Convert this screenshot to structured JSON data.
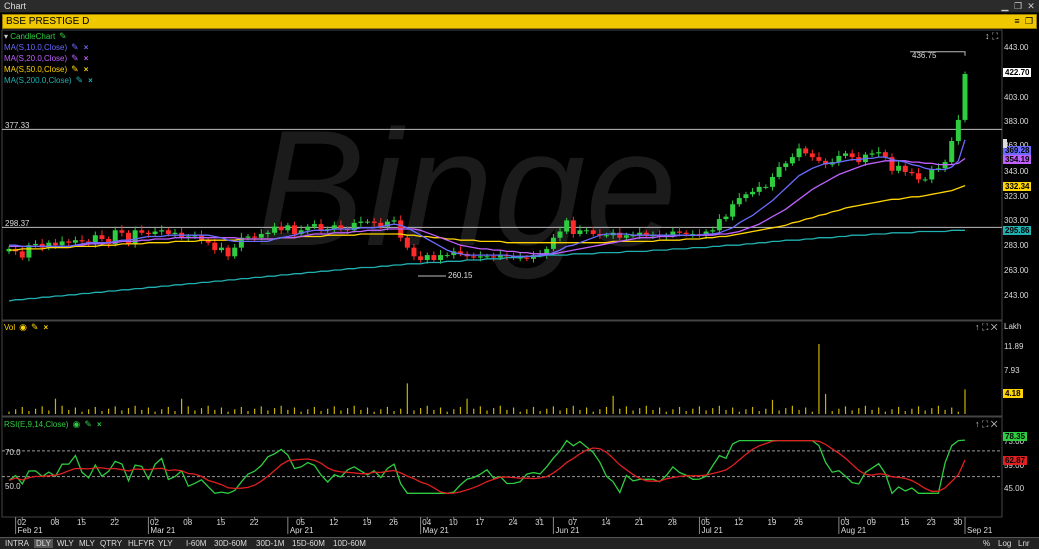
{
  "window": {
    "title": "Chart"
  },
  "header": {
    "symbol": "BSE PRESTIGE D"
  },
  "price_panel": {
    "legend": [
      {
        "label": "CandleChart",
        "color": "#2ecc40"
      },
      {
        "label": "MA(S,10.0,Close)",
        "color": "#6b6bff"
      },
      {
        "label": "MA(S,20.0,Close)",
        "color": "#c060ff"
      },
      {
        "label": "MA(S,50.0,Close)",
        "color": "#ffd400"
      },
      {
        "label": "MA(S,200.0,Close)",
        "color": "#20b0b0"
      }
    ],
    "y_ticks": [
      "443.00",
      "422.70",
      "403.00",
      "383.00",
      "363.00",
      "343.00",
      "323.00",
      "303.00",
      "283.00",
      "263.00",
      "243.00"
    ],
    "badges": [
      {
        "text": "369.28",
        "bg": "#6b6bff",
        "fg": "#000"
      },
      {
        "text": "354.19",
        "bg": "#c060ff",
        "fg": "#000"
      },
      {
        "text": "332.34",
        "bg": "#ffd400",
        "fg": "#000"
      },
      {
        "text": "295.86",
        "bg": "#20b0b0",
        "fg": "#000"
      },
      {
        "text": "422.70",
        "bg": "#ffffff",
        "fg": "#000"
      }
    ],
    "level_labels": [
      "377.33",
      "298.37"
    ],
    "annotations": [
      "436.75",
      "260.15"
    ],
    "watermark": "Binge"
  },
  "volume_panel": {
    "label": "Vol",
    "unit": "Lakh",
    "y_ticks": [
      "11.89",
      "7.93",
      "3.96"
    ],
    "badge": "4.18"
  },
  "rsi_panel": {
    "label": "RSI(E,9,14,Close)",
    "y_ticks": [
      "73.00",
      "59.00",
      "45.00"
    ],
    "level_labels": [
      "70.0",
      "50.0"
    ],
    "badges": [
      {
        "text": "78.35",
        "bg": "#2ecc40",
        "fg": "#000"
      },
      {
        "text": "62.87",
        "bg": "#e02020",
        "fg": "#000"
      }
    ]
  },
  "x_axis": {
    "day_labels": [
      "02",
      "08",
      "15",
      "22",
      "02",
      "08",
      "15",
      "22",
      "05",
      "12",
      "19",
      "26",
      "04",
      "10",
      "17",
      "24",
      "31",
      "07",
      "14",
      "21",
      "28",
      "05",
      "12",
      "19",
      "26",
      "03",
      "09",
      "16",
      "23",
      "30"
    ],
    "month_labels": [
      "Feb 21",
      "Mar 21",
      "Apr 21",
      "May 21",
      "Jun 21",
      "Jul 21",
      "Aug 21",
      "Sep 21"
    ]
  },
  "bottom_bar": {
    "periodicity": [
      "INTRA",
      "DLY",
      "WLY",
      "MLY",
      "QTRY",
      "HLFYR",
      "YLY"
    ],
    "selected": "DLY",
    "intraday": [
      "I-60M",
      "30D-60M",
      "30D-1M",
      "15D-60M",
      "10D-60M"
    ],
    "right_buttons": [
      "%",
      "Log",
      "Lnr"
    ]
  },
  "chart_data": {
    "type": "candlestick",
    "title": "BSE PRESTIGE D",
    "x": [
      "2021-01-29",
      "2021-02-01",
      "2021-02-02",
      "2021-02-03",
      "2021-02-04",
      "2021-02-05",
      "2021-02-08",
      "2021-02-09",
      "2021-02-10",
      "2021-02-11",
      "2021-02-12",
      "2021-02-15",
      "2021-02-16",
      "2021-02-17",
      "2021-02-18",
      "2021-02-19",
      "2021-02-22",
      "2021-02-23",
      "2021-02-24",
      "2021-02-25",
      "2021-02-26",
      "2021-03-01",
      "2021-03-02",
      "2021-03-03",
      "2021-03-04",
      "2021-03-05",
      "2021-03-08",
      "2021-03-09",
      "2021-03-10",
      "2021-03-12",
      "2021-03-15",
      "2021-03-16",
      "2021-03-17",
      "2021-03-18",
      "2021-03-19",
      "2021-03-22",
      "2021-03-23",
      "2021-03-24",
      "2021-03-25",
      "2021-03-26",
      "2021-03-30",
      "2021-03-31",
      "2021-04-01",
      "2021-04-05",
      "2021-04-06",
      "2021-04-07",
      "2021-04-08",
      "2021-04-09",
      "2021-04-12",
      "2021-04-13",
      "2021-04-15",
      "2021-04-16",
      "2021-04-19",
      "2021-04-20",
      "2021-04-22",
      "2021-04-23",
      "2021-04-26",
      "2021-04-27",
      "2021-04-28",
      "2021-04-29",
      "2021-04-30",
      "2021-05-03",
      "2021-05-04",
      "2021-05-05",
      "2021-05-06",
      "2021-05-07",
      "2021-05-10",
      "2021-05-11",
      "2021-05-12",
      "2021-05-14",
      "2021-05-17",
      "2021-05-18",
      "2021-05-19",
      "2021-05-20",
      "2021-05-21",
      "2021-05-24",
      "2021-05-25",
      "2021-05-26",
      "2021-05-27",
      "2021-05-28",
      "2021-05-31",
      "2021-06-01",
      "2021-06-02",
      "2021-06-03",
      "2021-06-04",
      "2021-06-07",
      "2021-06-08",
      "2021-06-09",
      "2021-06-10",
      "2021-06-11",
      "2021-06-14",
      "2021-06-15",
      "2021-06-16",
      "2021-06-17",
      "2021-06-18",
      "2021-06-21",
      "2021-06-22",
      "2021-06-23",
      "2021-06-24",
      "2021-06-25",
      "2021-06-28",
      "2021-06-29",
      "2021-06-30",
      "2021-07-01",
      "2021-07-02",
      "2021-07-05",
      "2021-07-06",
      "2021-07-07",
      "2021-07-08",
      "2021-07-09",
      "2021-07-12",
      "2021-07-13",
      "2021-07-14",
      "2021-07-15",
      "2021-07-16",
      "2021-07-19",
      "2021-07-20",
      "2021-07-22",
      "2021-07-23",
      "2021-07-26",
      "2021-07-27",
      "2021-07-28",
      "2021-07-29",
      "2021-07-30",
      "2021-08-02",
      "2021-08-03",
      "2021-08-04",
      "2021-08-05",
      "2021-08-06",
      "2021-08-09",
      "2021-08-10",
      "2021-08-11",
      "2021-08-12",
      "2021-08-13",
      "2021-08-16",
      "2021-08-17",
      "2021-08-18",
      "2021-08-20",
      "2021-08-23",
      "2021-08-24",
      "2021-08-25",
      "2021-08-26",
      "2021-08-27",
      "2021-08-30",
      "2021-08-31",
      "2021-09-01"
    ],
    "close": [
      281,
      279,
      274,
      284,
      285,
      282,
      286,
      284,
      287,
      286,
      288,
      287,
      285,
      292,
      289,
      285,
      296,
      294,
      285,
      296,
      294,
      293,
      295,
      296,
      293,
      294,
      290,
      291,
      292,
      288,
      286,
      280,
      282,
      275,
      282,
      290,
      291,
      290,
      293,
      294,
      299,
      296,
      300,
      293,
      296,
      299,
      301,
      296,
      297,
      300,
      297,
      296,
      302,
      303,
      303,
      302,
      299,
      303,
      304,
      290,
      282,
      275,
      272,
      276,
      272,
      276,
      276,
      279,
      277,
      275,
      274,
      275,
      275,
      274,
      276,
      275,
      274,
      274,
      273,
      276,
      276,
      281,
      290,
      295,
      304,
      293,
      296,
      296,
      293,
      292,
      292,
      294,
      290,
      292,
      292,
      294,
      292,
      292,
      291,
      292,
      295,
      294,
      293,
      293,
      292,
      295,
      296,
      305,
      307,
      317,
      322,
      325,
      327,
      331,
      331,
      339,
      347,
      350,
      355,
      362,
      358,
      355,
      352,
      349,
      351,
      356,
      358,
      355,
      351,
      357,
      358,
      359,
      355,
      344,
      348,
      343,
      342,
      337,
      337,
      345,
      346,
      351,
      368,
      385,
      422
    ],
    "ma10": [
      284,
      284,
      283,
      283,
      283,
      283,
      283,
      283,
      283,
      283,
      284,
      285,
      286,
      286,
      286,
      286,
      287,
      288,
      288,
      289,
      290,
      291,
      291,
      291,
      292,
      292,
      292,
      292,
      292,
      292,
      292,
      291,
      290,
      288,
      287,
      287,
      287,
      287,
      287,
      287,
      289,
      290,
      291,
      292,
      294,
      295,
      296,
      296,
      296,
      297,
      297,
      297,
      297,
      298,
      298,
      298,
      299,
      300,
      301,
      300,
      298,
      295,
      292,
      289,
      286,
      283,
      280,
      278,
      277,
      276,
      276,
      276,
      276,
      276,
      276,
      276,
      275,
      275,
      275,
      275,
      276,
      276,
      278,
      280,
      283,
      284,
      286,
      288,
      290,
      292,
      293,
      293,
      293,
      293,
      292,
      292,
      292,
      292,
      292,
      292,
      292,
      292,
      292,
      292,
      292,
      293,
      293,
      294,
      296,
      298,
      302,
      305,
      308,
      312,
      316,
      320,
      325,
      330,
      335,
      340,
      343,
      346,
      348,
      350,
      350,
      351,
      352,
      353,
      353,
      354,
      354,
      355,
      355,
      353,
      352,
      351,
      349,
      348,
      346,
      345,
      345,
      345,
      347,
      352,
      369
    ],
    "ma20": [
      283,
      283,
      283,
      283,
      283,
      283,
      283,
      283,
      283,
      283,
      284,
      284,
      285,
      285,
      285,
      286,
      286,
      287,
      287,
      287,
      288,
      288,
      289,
      289,
      289,
      290,
      290,
      290,
      290,
      290,
      290,
      290,
      290,
      290,
      290,
      289,
      289,
      289,
      289,
      289,
      289,
      290,
      290,
      290,
      291,
      292,
      293,
      293,
      293,
      294,
      294,
      294,
      295,
      295,
      296,
      296,
      296,
      297,
      297,
      297,
      297,
      297,
      296,
      294,
      292,
      290,
      288,
      286,
      284,
      283,
      282,
      281,
      281,
      280,
      280,
      279,
      279,
      278,
      278,
      277,
      277,
      277,
      277,
      278,
      279,
      280,
      281,
      282,
      283,
      284,
      285,
      286,
      287,
      288,
      289,
      290,
      290,
      290,
      291,
      291,
      291,
      292,
      292,
      292,
      292,
      292,
      292,
      293,
      293,
      294,
      295,
      297,
      299,
      301,
      304,
      307,
      310,
      313,
      317,
      321,
      325,
      329,
      332,
      335,
      338,
      341,
      343,
      345,
      347,
      349,
      350,
      351,
      352,
      352,
      352,
      352,
      351,
      351,
      350,
      350,
      349,
      349,
      349,
      350,
      354
    ],
    "ma50": [
      280,
      280,
      281,
      281,
      281,
      281,
      282,
      282,
      282,
      282,
      283,
      283,
      283,
      283,
      284,
      284,
      284,
      285,
      285,
      285,
      285,
      286,
      286,
      286,
      286,
      287,
      287,
      287,
      287,
      288,
      288,
      288,
      288,
      288,
      288,
      289,
      289,
      289,
      289,
      289,
      289,
      290,
      290,
      290,
      291,
      291,
      291,
      291,
      292,
      292,
      292,
      292,
      292,
      293,
      293,
      293,
      293,
      293,
      293,
      293,
      292,
      292,
      291,
      291,
      290,
      290,
      289,
      289,
      288,
      288,
      288,
      287,
      287,
      287,
      287,
      286,
      286,
      286,
      286,
      286,
      286,
      286,
      286,
      286,
      286,
      286,
      286,
      286,
      286,
      286,
      286,
      287,
      287,
      287,
      287,
      287,
      287,
      287,
      288,
      288,
      288,
      288,
      289,
      289,
      289,
      290,
      290,
      291,
      291,
      292,
      293,
      294,
      295,
      296,
      297,
      298,
      299,
      300,
      302,
      303,
      305,
      306,
      308,
      309,
      311,
      312,
      314,
      315,
      316,
      317,
      318,
      319,
      320,
      321,
      321,
      322,
      323,
      323,
      324,
      325,
      326,
      327,
      328,
      330,
      332
    ],
    "ma200": [
      239,
      240,
      240,
      241,
      241,
      242,
      242,
      243,
      243,
      244,
      244,
      245,
      245,
      246,
      246,
      247,
      247,
      248,
      248,
      249,
      249,
      250,
      250,
      251,
      251,
      252,
      252,
      253,
      253,
      254,
      254,
      255,
      255,
      256,
      256,
      257,
      257,
      258,
      258,
      259,
      259,
      260,
      260,
      261,
      261,
      262,
      262,
      263,
      263,
      264,
      264,
      265,
      265,
      266,
      266,
      266,
      267,
      267,
      268,
      268,
      269,
      269,
      269,
      270,
      270,
      270,
      271,
      271,
      271,
      272,
      272,
      272,
      273,
      273,
      273,
      274,
      274,
      274,
      275,
      275,
      275,
      276,
      276,
      276,
      276,
      277,
      277,
      277,
      277,
      278,
      278,
      278,
      278,
      279,
      279,
      279,
      279,
      280,
      280,
      280,
      281,
      281,
      281,
      282,
      282,
      282,
      283,
      283,
      284,
      284,
      284,
      285,
      285,
      286,
      286,
      287,
      287,
      288,
      288,
      288,
      289,
      289,
      290,
      290,
      290,
      291,
      291,
      292,
      292,
      292,
      293,
      293,
      293,
      294,
      294,
      294,
      294,
      295,
      295,
      295,
      295,
      295,
      296,
      296,
      296
    ],
    "last_values": {
      "ma10": 369.28,
      "ma20": 354.19,
      "ma50": 332.34,
      "ma200": 295.86,
      "close": 422.7,
      "high": 436.75
    },
    "levels": [
      377.33,
      298.37
    ],
    "low_marker": 260.15,
    "ylim": [
      233,
      450
    ],
    "volume_ylim": [
      0,
      14
    ],
    "volume_last": 4.18,
    "rsi_ylim": [
      35,
      80
    ],
    "rsi_levels": [
      70,
      50
    ],
    "rsi_last": 78.35,
    "rsi_signal_last": 62.87
  }
}
